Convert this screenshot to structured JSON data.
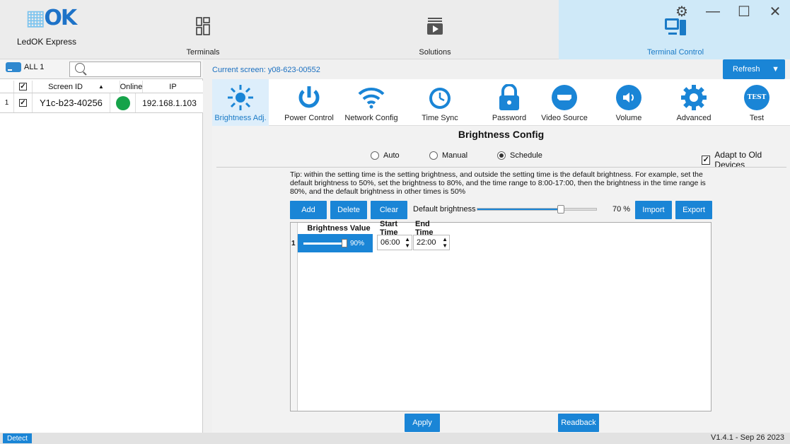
{
  "app": {
    "brand": "OK",
    "name": "LedOK Express"
  },
  "nav": {
    "terminals": "Terminals",
    "solutions": "Solutions",
    "terminal_control": "Terminal Control"
  },
  "left": {
    "all_label": "ALL 1",
    "columns": [
      "Screen ID",
      "Online",
      "IP"
    ],
    "rows": [
      {
        "index": "1",
        "screen_id": "Y1c-b23-40256",
        "ip": "192.168.1.103"
      }
    ]
  },
  "current_screen": "Current screen: y08-623-00552",
  "refresh_label": "Refresh",
  "tools": [
    "Brightness Adj.",
    "Power Control",
    "Network Config",
    "Time Sync",
    "Password",
    "Video Source",
    "Volume",
    "Advanced",
    "Test"
  ],
  "test_icon_text": "TEST",
  "config": {
    "title": "Brightness Config",
    "modes": [
      "Auto",
      "Manual",
      "Schedule"
    ],
    "selected_mode": "Schedule",
    "adapt_label": "Adapt to Old Devices",
    "tip": "Tip: within the setting time is the setting brightness, and outside the setting time is the default brightness. For example, set the default brightness to 50%, set the brightness to 80%, and the time range to 8:00-17:00, then the brightness in the time range is 80%, and the default brightness in other times is 50%",
    "buttons": {
      "add": "Add",
      "delete": "Delete",
      "clear": "Clear",
      "import": "Import",
      "export": "Export"
    },
    "default_brightness_label": "Default brightness",
    "default_brightness_value": "70 %",
    "default_brightness_fraction": 0.7,
    "table": {
      "headers": [
        "Brightness Value",
        "Start Time",
        "End Time"
      ],
      "rows": [
        {
          "index": "1",
          "brightness": "90%",
          "start": "06:00",
          "end": "22:00"
        }
      ]
    },
    "apply": "Apply",
    "readback": "Readback"
  },
  "status": {
    "detect": "Detect",
    "version": "V1.4.1 - Sep 26 2023"
  }
}
